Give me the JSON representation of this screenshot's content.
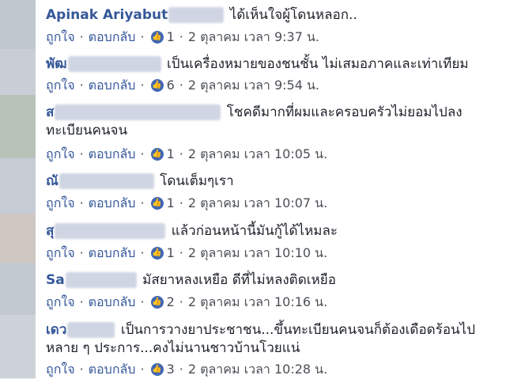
{
  "actions": {
    "like": "ถูกใจ",
    "reply": "ตอบกลับ",
    "dot": "·"
  },
  "comments": [
    {
      "name": "Apinak Ariyabut",
      "text": "ได้เห็นใจผู้โดนหลอก..",
      "text2": "",
      "likes": "1",
      "time": "2 ตุลาคม เวลา 9:37 น."
    },
    {
      "name": "พัฒ",
      "text": "เป็นเครื่องหมายของชนชั้น ไม่เสมอภาคและเท่าเทียม",
      "text2": "",
      "likes": "6",
      "time": "2 ตุลาคม เวลา 9:54 น."
    },
    {
      "name": "ส",
      "text": "โชคดีมากที่ผมและครอบครัวไม่ยอมไปลง",
      "text2": "ทะเบียนคนจน",
      "likes": "1",
      "time": "2 ตุลาคม เวลา 10:05 น."
    },
    {
      "name": "ณั",
      "text": "โดนเต็มๆเรา",
      "text2": "",
      "likes": "1",
      "time": "2 ตุลาคม เวลา 10:07 น."
    },
    {
      "name": "สุ",
      "text": "แล้วก่อนหน้านี้มันกู้ได้ไหมละ",
      "text2": "",
      "likes": "1",
      "time": "2 ตุลาคม เวลา 10:10 น."
    },
    {
      "name": "Sa",
      "text": "มัสยาหลงเหยือ ดีที่ไม่หลงติดเหยือ",
      "text2": "",
      "likes": "2",
      "time": "2 ตุลาคม เวลา 10:16 น."
    },
    {
      "name": "เดว",
      "text": "เป็นการวางยาประชาชน...ขึ้นทะเบียนคนจนก็ต้องเดือดร้อนไป",
      "text2": "หลาย ๆ ประการ...คงไม่นานชาวบ้านโวยแน่",
      "likes": "3",
      "time": "2 ตุลาคม เวลา 10:28 น."
    }
  ]
}
